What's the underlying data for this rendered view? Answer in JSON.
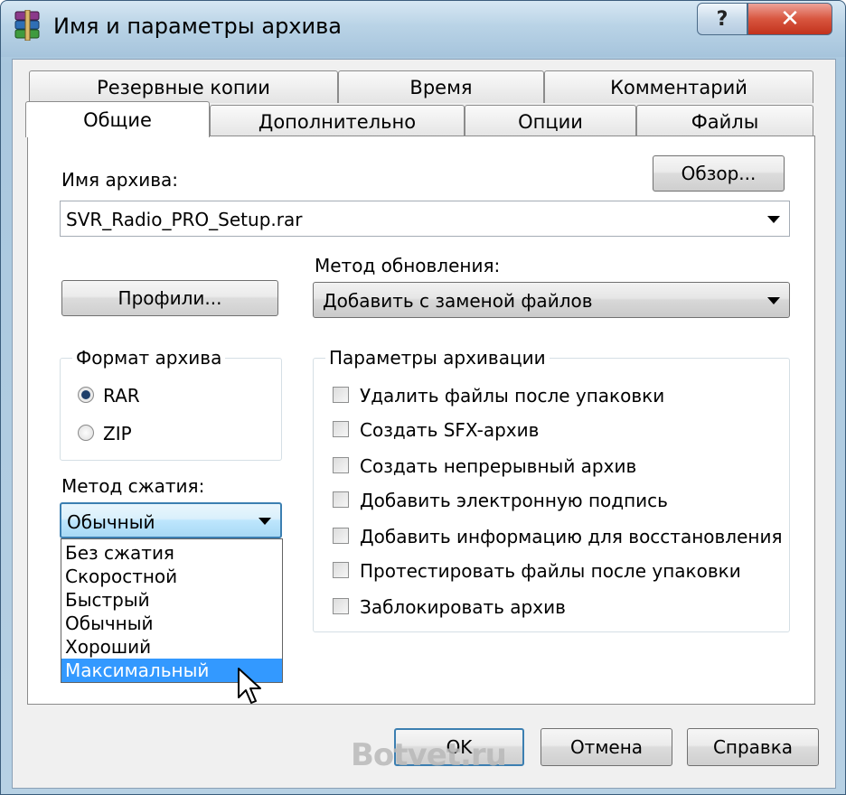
{
  "window": {
    "title": "Имя и параметры архива",
    "help_glyph": "?",
    "close_glyph": "✕"
  },
  "tabs_back": [
    "Резервные копии",
    "Время",
    "Комментарий"
  ],
  "tabs_front": [
    "Общие",
    "Дополнительно",
    "Опции",
    "Файлы"
  ],
  "active_tab": "Общие",
  "archive_name": {
    "label": "Имя архива:",
    "value": "SVR_Radio_PRO_Setup.rar",
    "browse_label": "Обзор..."
  },
  "profiles_label": "Профили...",
  "update_method": {
    "label": "Метод обновления:",
    "value": "Добавить с заменой файлов"
  },
  "archive_format": {
    "title": "Формат архива",
    "options": [
      "RAR",
      "ZIP"
    ],
    "selected": "RAR"
  },
  "compression": {
    "label": "Метод сжатия:",
    "value": "Обычный",
    "options": [
      "Без сжатия",
      "Скоростной",
      "Быстрый",
      "Обычный",
      "Хороший",
      "Максимальный"
    ],
    "highlighted": "Максимальный"
  },
  "archive_options": {
    "title": "Параметры архивации",
    "items": [
      {
        "label": "Удалить файлы после упаковки",
        "checked": false
      },
      {
        "label": "Создать SFX-архив",
        "checked": false
      },
      {
        "label": "Создать непрерывный архив",
        "checked": false
      },
      {
        "label": "Добавить электронную подпись",
        "checked": false
      },
      {
        "label": "Добавить информацию для восстановления",
        "checked": false
      },
      {
        "label": "Протестировать файлы после упаковки",
        "checked": false
      },
      {
        "label": "Заблокировать архив",
        "checked": false
      }
    ]
  },
  "buttons": {
    "ok": "OK",
    "cancel": "Отмена",
    "help": "Справка"
  },
  "watermark": "Botvet.ru"
}
